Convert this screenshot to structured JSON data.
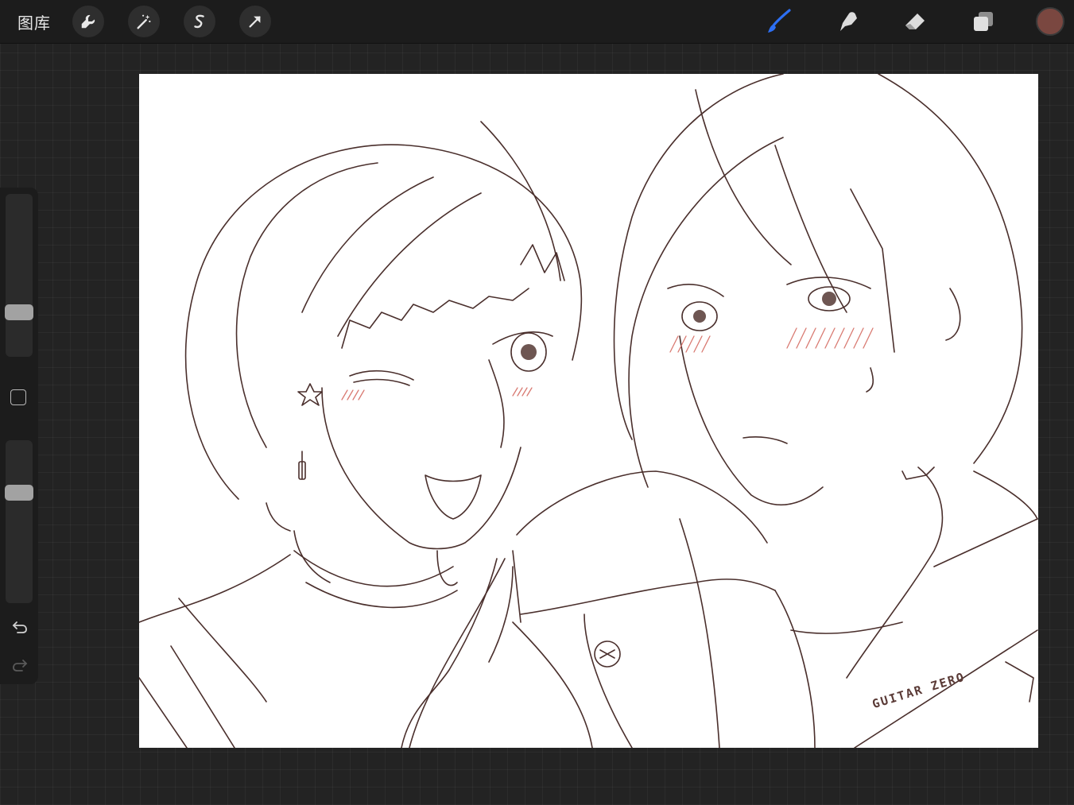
{
  "topbar": {
    "gallery_label": "图库",
    "left_tools": [
      {
        "name": "actions",
        "icon": "wrench-icon"
      },
      {
        "name": "adjustments",
        "icon": "magic-wand-icon"
      },
      {
        "name": "selection",
        "icon": "selection-s-icon"
      },
      {
        "name": "transform",
        "icon": "arrow-cursor-icon"
      }
    ],
    "right_tools": [
      {
        "name": "brush",
        "icon": "brush-icon",
        "active": true
      },
      {
        "name": "smudge",
        "icon": "smudge-finger-icon"
      },
      {
        "name": "eraser",
        "icon": "eraser-icon"
      },
      {
        "name": "layers",
        "icon": "layers-icon"
      }
    ],
    "current_color": "#7a4740",
    "active_color": "#2d6ff3"
  },
  "sidebar": {
    "brush_size_level": 0.25,
    "opacity_level": 0.7,
    "icons": [
      "modify-square-icon",
      "undo-icon",
      "redo-icon"
    ]
  },
  "canvas": {
    "background": "#ffffff",
    "line_color": "#4a2f2c",
    "blush_color": "#d97a72",
    "signature_text": "GUITAR ZERO"
  }
}
